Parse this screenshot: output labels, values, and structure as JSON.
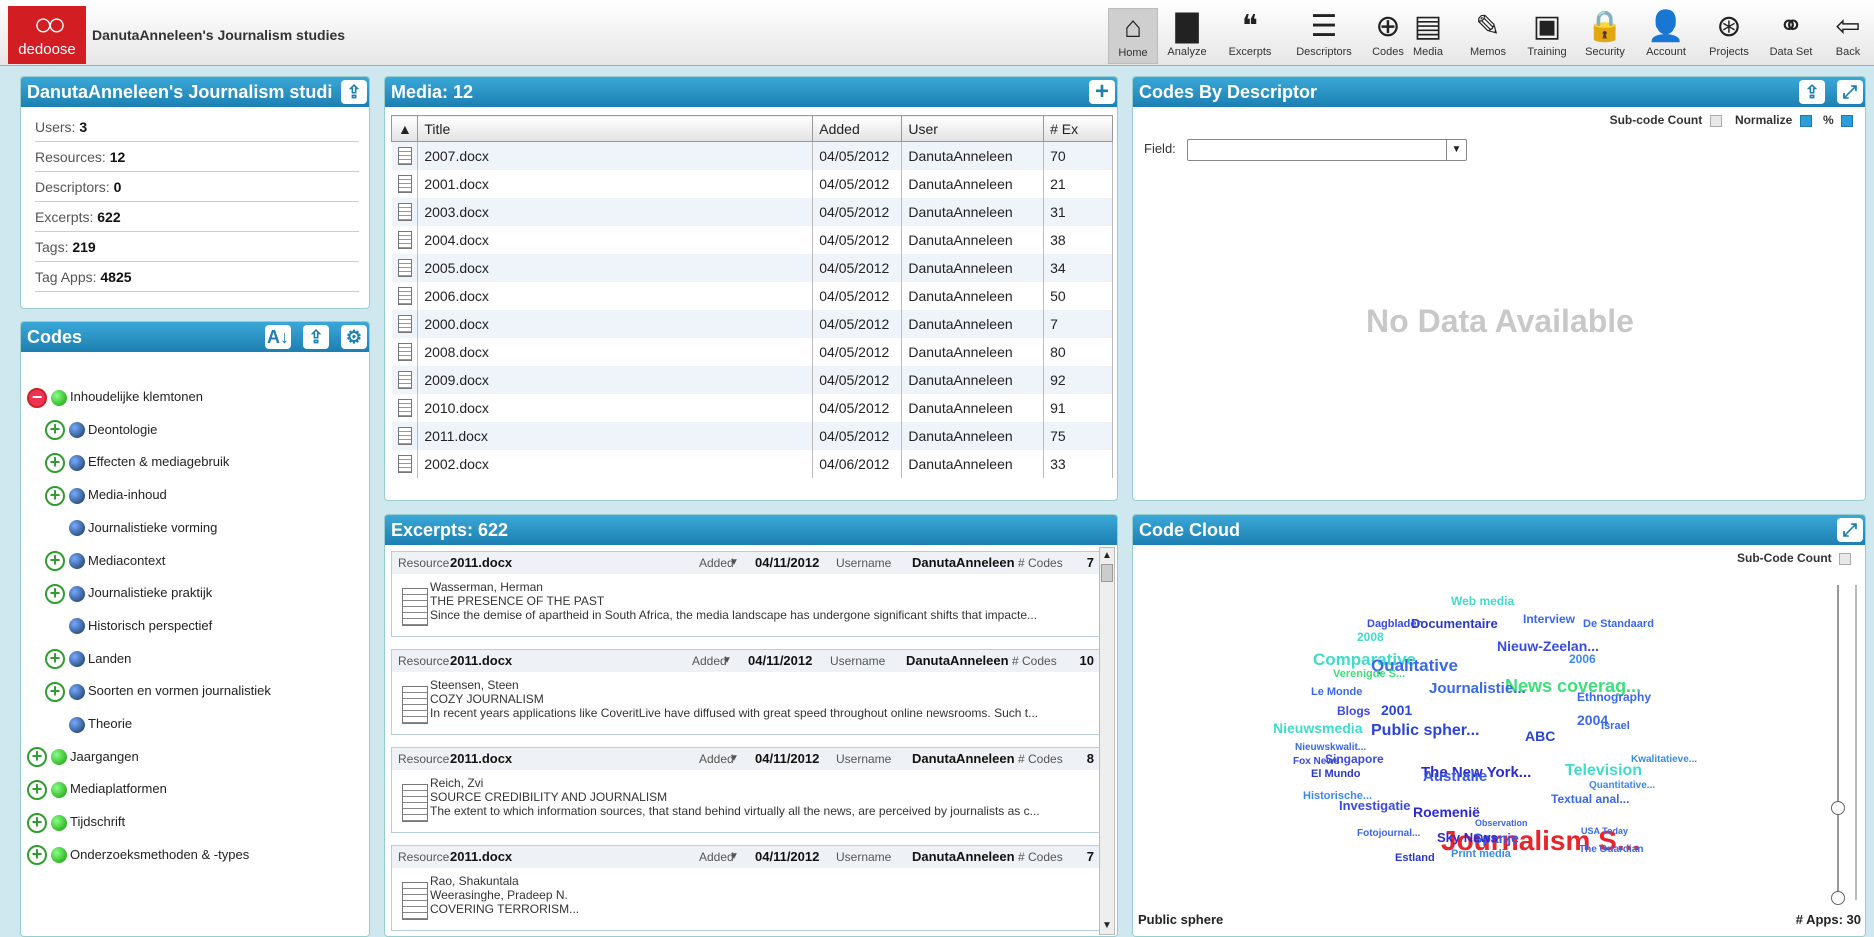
{
  "app": {
    "logo_text": "dedoose",
    "project_title": "DanutaAnneleen's Journalism studies"
  },
  "nav": [
    {
      "label": "Home",
      "icon": "home-icon",
      "glyph": "⌂"
    },
    {
      "label": "Analyze",
      "icon": "analyze-icon",
      "glyph": "▇"
    },
    {
      "label": "Excerpts",
      "icon": "excerpts-icon",
      "glyph": "❝"
    },
    {
      "label": "Descriptors",
      "icon": "descriptors-icon",
      "glyph": "☰"
    },
    {
      "label": "Codes",
      "icon": "codes-icon",
      "glyph": "⊕"
    },
    {
      "label": "Media",
      "icon": "media-icon",
      "glyph": "▤"
    },
    {
      "label": "Memos",
      "icon": "memos-icon",
      "glyph": "✎"
    },
    {
      "label": "Training",
      "icon": "training-icon",
      "glyph": "▣"
    },
    {
      "label": "Security",
      "icon": "security-icon",
      "glyph": "🔒"
    },
    {
      "label": "Account",
      "icon": "account-icon",
      "glyph": "👤"
    },
    {
      "label": "Projects",
      "icon": "projects-icon",
      "glyph": "⊛"
    },
    {
      "label": "Data Set",
      "icon": "dataset-icon",
      "glyph": "⚭"
    },
    {
      "label": "Back",
      "icon": "back-icon",
      "glyph": "⇦"
    }
  ],
  "project_panel": {
    "title": "DanutaAnneleen's Journalism studi",
    "stats": [
      {
        "label": "Users:",
        "value": "3"
      },
      {
        "label": "Resources:",
        "value": "12"
      },
      {
        "label": "Descriptors:",
        "value": "0"
      },
      {
        "label": "Excerpts:",
        "value": "622"
      },
      {
        "label": "Tags:",
        "value": "219"
      },
      {
        "label": "Tag Apps:",
        "value": "4825"
      }
    ]
  },
  "codes_panel": {
    "title": "Codes",
    "items": [
      {
        "label": "Inhoudelijke klemtonen",
        "level": 0,
        "expander": "minus",
        "color": "green"
      },
      {
        "label": "Deontologie",
        "level": 1,
        "expander": "plus",
        "color": "blue"
      },
      {
        "label": "Effecten & mediagebruik",
        "level": 1,
        "expander": "plus",
        "color": "blue"
      },
      {
        "label": "Media-inhoud",
        "level": 1,
        "expander": "plus",
        "color": "blue"
      },
      {
        "label": "Journalistieke vorming",
        "level": 1,
        "expander": "none",
        "color": "blue"
      },
      {
        "label": "Mediacontext",
        "level": 1,
        "expander": "plus",
        "color": "blue"
      },
      {
        "label": "Journalistieke praktijk",
        "level": 1,
        "expander": "plus",
        "color": "blue"
      },
      {
        "label": "Historisch perspectief",
        "level": 1,
        "expander": "none",
        "color": "blue"
      },
      {
        "label": "Landen",
        "level": 1,
        "expander": "plus",
        "color": "blue"
      },
      {
        "label": "Soorten en vormen journalistiek",
        "level": 1,
        "expander": "plus",
        "color": "blue"
      },
      {
        "label": "Theorie",
        "level": 1,
        "expander": "none",
        "color": "blue"
      },
      {
        "label": "Jaargangen",
        "level": 0,
        "expander": "plus",
        "color": "green"
      },
      {
        "label": "Mediaplatformen",
        "level": 0,
        "expander": "plus",
        "color": "green"
      },
      {
        "label": "Tijdschrift",
        "level": 0,
        "expander": "plus",
        "color": "green"
      },
      {
        "label": "Onderzoeksmethoden & -types",
        "level": 0,
        "expander": "plus",
        "color": "green"
      }
    ]
  },
  "media_panel": {
    "title": "Media: 12",
    "columns": [
      "▲",
      "Title",
      "Added",
      "User",
      "# Ex"
    ],
    "rows": [
      [
        "2007.docx",
        "04/05/2012",
        "DanutaAnneleen",
        "70"
      ],
      [
        "2001.docx",
        "04/05/2012",
        "DanutaAnneleen",
        "21"
      ],
      [
        "2003.docx",
        "04/05/2012",
        "DanutaAnneleen",
        "31"
      ],
      [
        "2004.docx",
        "04/05/2012",
        "DanutaAnneleen",
        "38"
      ],
      [
        "2005.docx",
        "04/05/2012",
        "DanutaAnneleen",
        "34"
      ],
      [
        "2006.docx",
        "04/05/2012",
        "DanutaAnneleen",
        "50"
      ],
      [
        "2000.docx",
        "04/05/2012",
        "DanutaAnneleen",
        "7"
      ],
      [
        "2008.docx",
        "04/05/2012",
        "DanutaAnneleen",
        "80"
      ],
      [
        "2009.docx",
        "04/05/2012",
        "DanutaAnneleen",
        "92"
      ],
      [
        "2010.docx",
        "04/05/2012",
        "DanutaAnneleen",
        "91"
      ],
      [
        "2011.docx",
        "04/05/2012",
        "DanutaAnneleen",
        "75"
      ],
      [
        "2002.docx",
        "04/06/2012",
        "DanutaAnneleen",
        "33"
      ]
    ]
  },
  "excerpts_panel": {
    "title": "Excerpts: 622",
    "labels": {
      "resource": "Resource",
      "added": "Added",
      "username": "Username",
      "codes": "# Codes"
    },
    "items": [
      {
        "resource": "2011.docx",
        "added": "04/11/2012",
        "username": "DanutaAnneleen",
        "codes": "7",
        "lines": [
          "Wasserman, Herman",
          "THE PRESENCE OF THE PAST",
          "Since the demise of apartheid in South Africa, the media landscape has undergone significant shifts that impacte..."
        ]
      },
      {
        "resource": "2011.docx",
        "added": "04/11/2012",
        "username": "DanutaAnneleen",
        "codes": "10",
        "lines": [
          "Steensen, Steen",
          "COZY JOURNALISM",
          "In recent years applications like CoveritLive have diffused with great speed throughout online newsrooms. Such t..."
        ]
      },
      {
        "resource": "2011.docx",
        "added": "04/11/2012",
        "username": "DanutaAnneleen",
        "codes": "8",
        "lines": [
          "Reich, Zvi",
          "SOURCE CREDIBILITY AND JOURNALISM",
          "The extent to which information sources, that stand behind virtually all the news, are perceived by journalists as c..."
        ]
      },
      {
        "resource": "2011.docx",
        "added": "04/11/2012",
        "username": "DanutaAnneleen",
        "codes": "7",
        "lines": [
          "Rao, Shakuntala",
          "Weerasinghe, Pradeep N.",
          "COVERING TERRORISM..."
        ]
      }
    ]
  },
  "descriptor_panel": {
    "title": "Codes By Descriptor",
    "subcode_label": "Sub-code Count",
    "normalize_label": "Normalize",
    "percent_label": "%",
    "field_label": "Field:",
    "field_value": "",
    "empty_text": "No Data Available"
  },
  "cloud_panel": {
    "title": "Code Cloud",
    "subcode_label": "Sub-Code Count",
    "hover_label": "Public sphere",
    "apps_label": "# Apps: 30",
    "words": [
      {
        "t": "Journalism S...",
        "c": "#e8242c",
        "s": 28
      },
      {
        "t": "News coverag...",
        "c": "#3ee07a",
        "s": 18
      },
      {
        "t": "Comparative",
        "c": "#3edcc9",
        "s": 17
      },
      {
        "t": "Qualitative",
        "c": "#3a68e8",
        "s": 17
      },
      {
        "t": "Public spher...",
        "c": "#2a44d8",
        "s": 16
      },
      {
        "t": "Journalistie...",
        "c": "#3a68e8",
        "s": 15
      },
      {
        "t": "The New York...",
        "c": "#2a2ad0",
        "s": 15
      },
      {
        "t": "Australie",
        "c": "#3a5ae0",
        "s": 15
      },
      {
        "t": "Nieuw-Zeelan...",
        "c": "#3a4ae0",
        "s": 14
      },
      {
        "t": "Television",
        "c": "#3edcc9",
        "s": 16
      },
      {
        "t": "Nieuwsmedia",
        "c": "#3edcc9",
        "s": 14
      },
      {
        "t": "Documentaire",
        "c": "#2a3ac0",
        "s": 13
      },
      {
        "t": "Roemenië",
        "c": "#2a2ad0",
        "s": 14
      },
      {
        "t": "Spanje",
        "c": "#3a5ae0",
        "s": 14
      },
      {
        "t": "Investigatie",
        "c": "#3a4ae0",
        "s": 13
      },
      {
        "t": "2001",
        "c": "#2a44d8",
        "s": 14
      },
      {
        "t": "2004",
        "c": "#3a68e8",
        "s": 14
      },
      {
        "t": "ABC",
        "c": "#2a44d8",
        "s": 14
      },
      {
        "t": "Singapore",
        "c": "#3a4ae0",
        "s": 12
      },
      {
        "t": "Blogs",
        "c": "#3a4ae0",
        "s": 12
      },
      {
        "t": "Sky News",
        "c": "#2a2ad0",
        "s": 13
      },
      {
        "t": "Le Monde",
        "c": "#3a68e8",
        "s": 11
      },
      {
        "t": "El Mundo",
        "c": "#2a3ac0",
        "s": 11
      },
      {
        "t": "Web media",
        "c": "#3edcc9",
        "s": 12
      },
      {
        "t": "Interview",
        "c": "#3a68e8",
        "s": 12
      },
      {
        "t": "Ethnography",
        "c": "#3a68e8",
        "s": 12
      },
      {
        "t": "Textual anal...",
        "c": "#3a68e8",
        "s": 12
      },
      {
        "t": "Historische...",
        "c": "#3a8ae8",
        "s": 11
      },
      {
        "t": "Verenigde S...",
        "c": "#3ee07a",
        "s": 11
      },
      {
        "t": "2008",
        "c": "#3edcc9",
        "s": 12
      },
      {
        "t": "2006",
        "c": "#3a8ae8",
        "s": 12
      },
      {
        "t": "Dagbladen",
        "c": "#3a4ae0",
        "s": 11
      },
      {
        "t": "De Standaard",
        "c": "#3a68e8",
        "s": 11
      },
      {
        "t": "Israel",
        "c": "#3a68e8",
        "s": 11
      },
      {
        "t": "Estland",
        "c": "#2a3ac0",
        "s": 11
      },
      {
        "t": "Print media",
        "c": "#3a8ae8",
        "s": 11
      },
      {
        "t": "Fotojournal...",
        "c": "#3a68e8",
        "s": 10
      },
      {
        "t": "Nieuwskwalit...",
        "c": "#3a68e8",
        "s": 10
      },
      {
        "t": "Fox News",
        "c": "#3a4ae0",
        "s": 10
      },
      {
        "t": "The Guardian",
        "c": "#3a68e8",
        "s": 10
      },
      {
        "t": "Quantitative...",
        "c": "#3a8ae8",
        "s": 10
      },
      {
        "t": "Kwalitatieve...",
        "c": "#3a8ae8",
        "s": 10
      },
      {
        "t": "Observation",
        "c": "#3a68e8",
        "s": 9
      },
      {
        "t": "USA Today",
        "c": "#3a68e8",
        "s": 9
      }
    ]
  }
}
